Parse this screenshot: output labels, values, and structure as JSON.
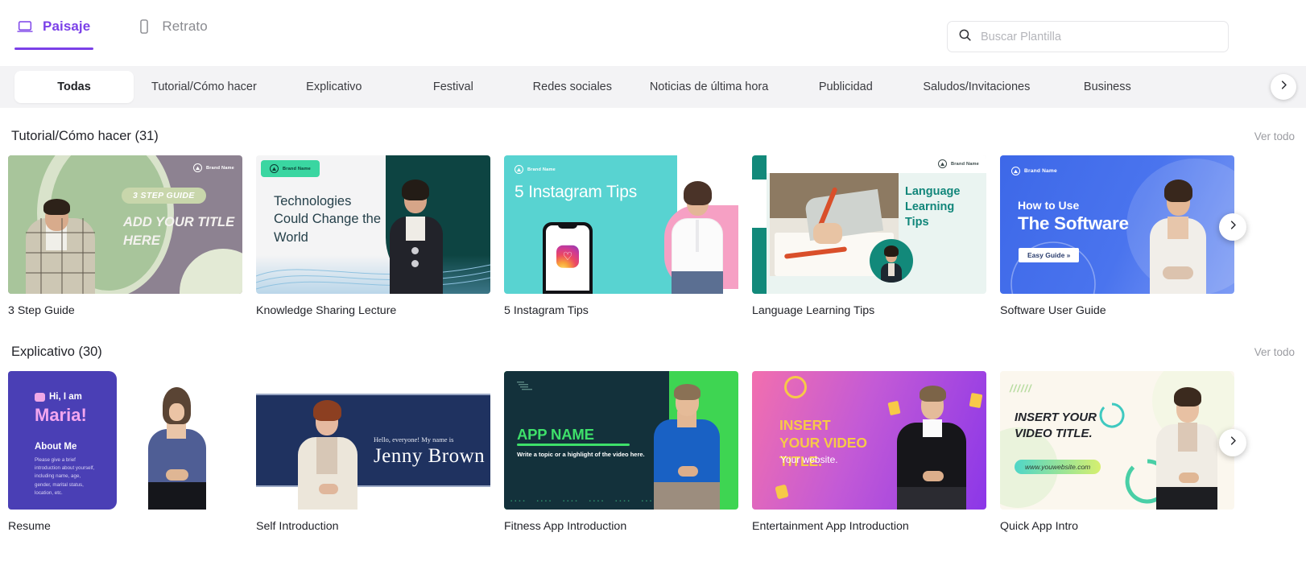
{
  "header": {
    "mode_tabs": [
      {
        "label": "Paisaje",
        "icon": "laptop-icon",
        "active": true
      },
      {
        "label": "Retrato",
        "icon": "phone-icon",
        "active": false
      }
    ],
    "search": {
      "placeholder": "Buscar Plantilla",
      "value": "",
      "icon": "search-icon"
    },
    "accent_color": "#7b40e8"
  },
  "categories": {
    "next_icon": "chevron-right-icon",
    "items": [
      {
        "label": "Todas",
        "active": true
      },
      {
        "label": "Tutorial/Cómo hacer",
        "active": false
      },
      {
        "label": "Explicativo",
        "active": false
      },
      {
        "label": "Festival",
        "active": false
      },
      {
        "label": "Redes sociales",
        "active": false
      },
      {
        "label": "Noticias de última hora",
        "active": false
      },
      {
        "label": "Publicidad",
        "active": false
      },
      {
        "label": "Saludos/Invitaciones",
        "active": false
      },
      {
        "label": "Business",
        "active": false
      }
    ]
  },
  "sections": [
    {
      "title": "Tutorial/Cómo hacer (31)",
      "see_all": "Ver todo",
      "next_icon": "chevron-right-icon",
      "cards": [
        {
          "label": "3 Step Guide",
          "art": "step-guide",
          "texts": {
            "badge": "3 STEP GUIDE",
            "title": "ADD YOUR TITLE HERE",
            "brand": "Brand Name"
          }
        },
        {
          "label": "Knowledge Sharing Lecture",
          "art": "knowledge",
          "texts": {
            "title": "Technologies Could Change the World",
            "brand": "Brand Name"
          }
        },
        {
          "label": "5 Instagram Tips",
          "art": "instagram",
          "texts": {
            "title": "5 Instagram Tips",
            "brand": "Brand Name"
          }
        },
        {
          "label": "Language Learning Tips",
          "art": "language",
          "texts": {
            "title": "Language Learning Tips",
            "brand": "Brand Name"
          }
        },
        {
          "label": "Software User Guide",
          "art": "software",
          "texts": {
            "kicker": "How to Use",
            "title": "The Software",
            "button": "Easy Guide »",
            "brand": "Brand Name"
          }
        }
      ]
    },
    {
      "title": "Explicativo (30)",
      "see_all": "Ver todo",
      "next_icon": "chevron-right-icon",
      "cards": [
        {
          "label": "Resume",
          "art": "resume",
          "texts": {
            "kicker": "Hi, I am",
            "title": "Maria!",
            "subtitle": "About Me",
            "body": "Please give a brief introduction about yourself, including name, age, gender, marital status, location, etc."
          }
        },
        {
          "label": "Self Introduction",
          "art": "selfintro",
          "texts": {
            "kicker": "Hello, everyone! My name is",
            "title": "Jenny Brown"
          }
        },
        {
          "label": "Fitness App Introduction",
          "art": "fitness",
          "texts": {
            "title": "APP NAME",
            "subtitle": "Write a topic or a highlight of the video here."
          }
        },
        {
          "label": "Entertainment App Introduction",
          "art": "enter",
          "texts": {
            "title": "INSERT YOUR VIDEO TITLE.",
            "subtitle": "Your website."
          }
        },
        {
          "label": "Quick App Intro",
          "art": "quick",
          "texts": {
            "title": "INSERT YOUR VIDEO TITLE.",
            "badge": "www.youwebsite.com"
          }
        }
      ]
    }
  ]
}
